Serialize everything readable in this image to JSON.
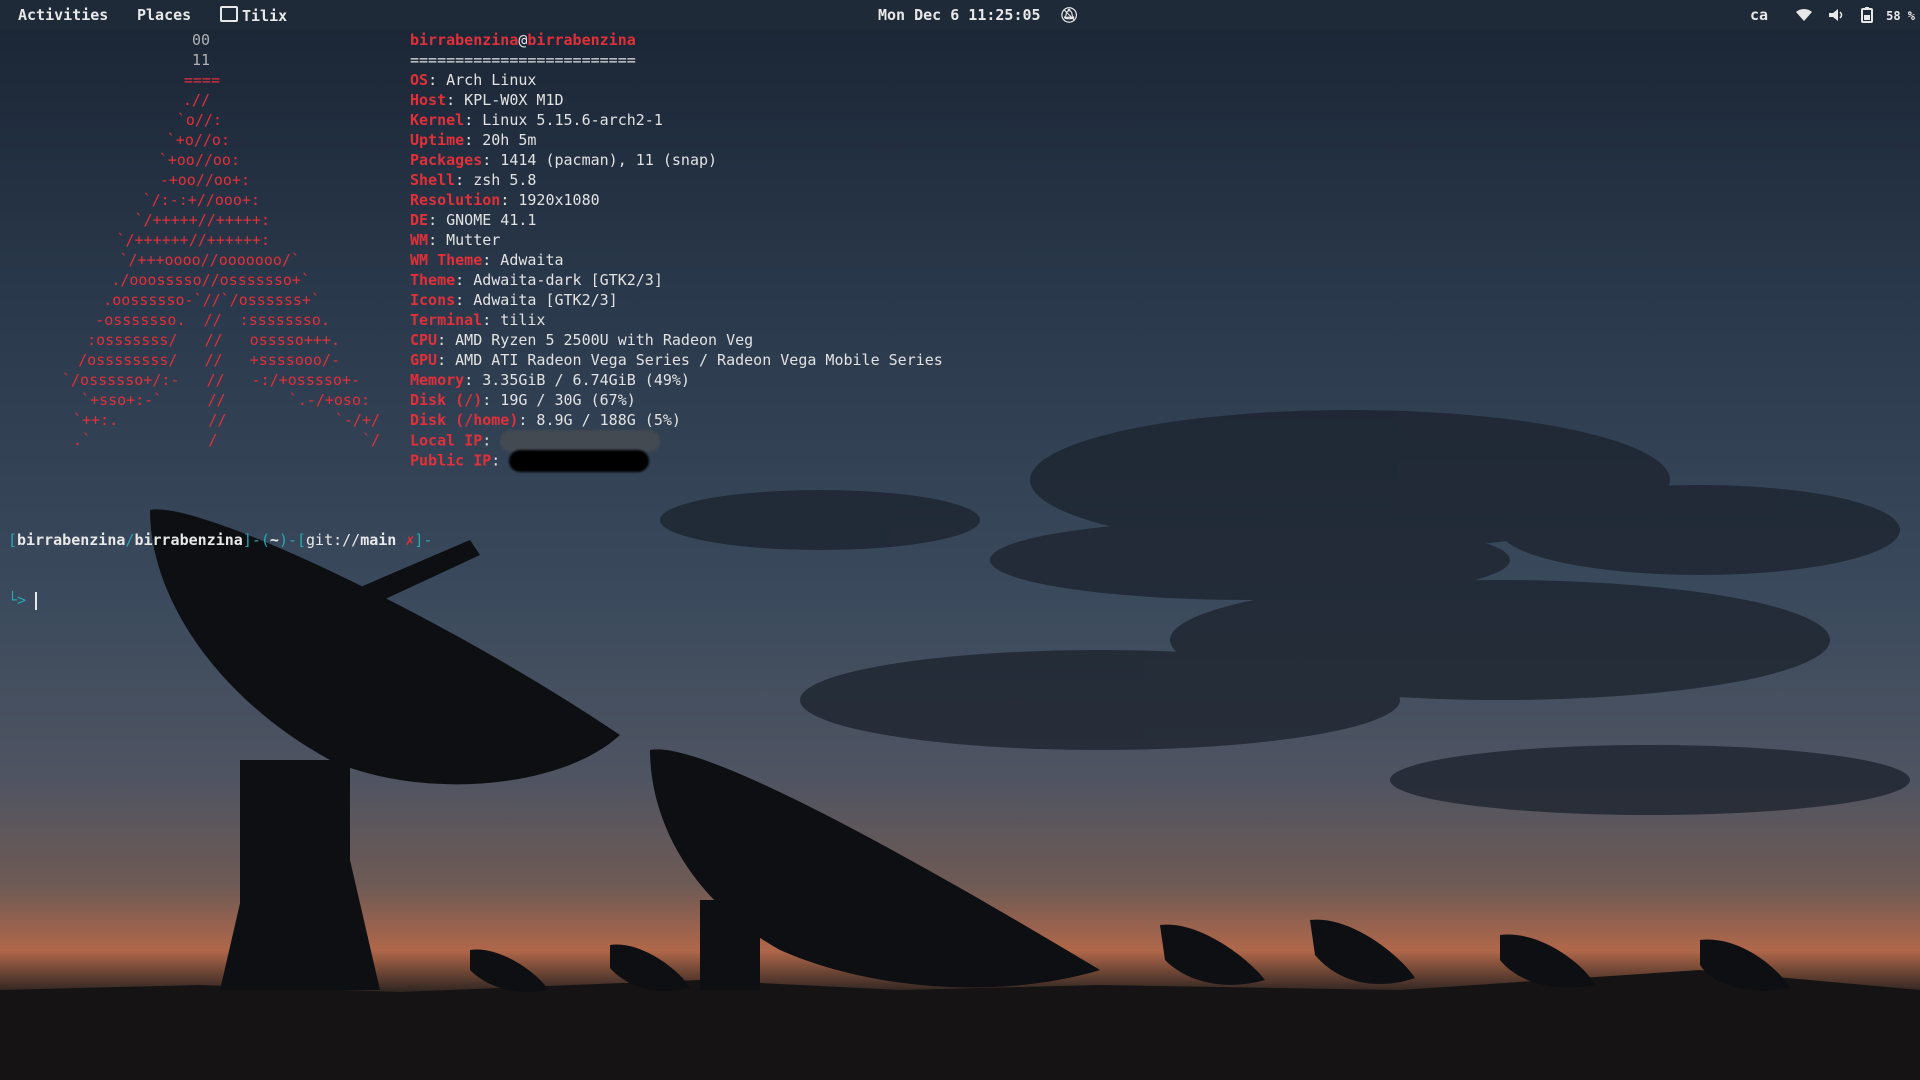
{
  "topbar": {
    "activities": "Activities",
    "places": "Places",
    "app_name": "Tilix",
    "clock": "Mon Dec 6 11:25:05",
    "keyboard_layout": "ca",
    "battery_percent": "58 %",
    "icons": [
      "terminal-icon",
      "notifications-off-icon",
      "wifi-icon",
      "volume-icon",
      "battery-icon"
    ]
  },
  "neofetch": {
    "user": "birrabenzina",
    "at": "@",
    "host": "birrabenzina",
    "separator": "=========================",
    "fields": [
      {
        "key": "OS",
        "value": ": Arch Linux"
      },
      {
        "key": "Host",
        "value": ": KPL-W0X M1D"
      },
      {
        "key": "Kernel",
        "value": ": Linux 5.15.6-arch2-1"
      },
      {
        "key": "Uptime",
        "value": ": 20h 5m"
      },
      {
        "key": "Packages",
        "value": ": 1414 (pacman), 11 (snap)"
      },
      {
        "key": "Shell",
        "value": ": zsh 5.8"
      },
      {
        "key": "Resolution",
        "value": ": 1920x1080"
      },
      {
        "key": "DE",
        "value": ": GNOME 41.1"
      },
      {
        "key": "WM",
        "value": ": Mutter"
      },
      {
        "key": "WM Theme",
        "value": ": Adwaita"
      },
      {
        "key": "Theme",
        "value": ": Adwaita-dark [GTK2/3]"
      },
      {
        "key": "Icons",
        "value": ": Adwaita [GTK2/3]"
      },
      {
        "key": "Terminal",
        "value": ": tilix"
      },
      {
        "key": "CPU",
        "value": ": AMD Ryzen 5 2500U with Radeon Veg"
      },
      {
        "key": "GPU",
        "value": ": AMD ATI Radeon Vega Series / Radeon Vega Mobile Series"
      },
      {
        "key": "Memory",
        "value": ": 3.35GiB / 6.74GiB (49%)"
      },
      {
        "key": "Disk (/)",
        "value": ": 19G / 30G (67%)"
      },
      {
        "key": "Disk (/home)",
        "value": ": 8.9G / 188G (5%)"
      },
      {
        "key": "Local IP",
        "value": ": "
      },
      {
        "key": "Public IP",
        "value": ": "
      }
    ],
    "logo_lines": [
      "00",
      "11",
      "====",
      ".//",
      "`o//:",
      "`+o//o:",
      "`+oo//oo:",
      "-+oo//oo+:",
      "`/:-:+//ooo+:",
      "`/+++++//+++++:",
      "`/++++++//++++++:",
      "`/+++oooo//ooooooo/`",
      "./ooosssso//osssssso+`",
      ".oossssso-`//`/ossssss+`",
      "-osssssso.  //  :ssssssso.",
      ":osssssss/   //   osssso+++.",
      "/ossssssss/   //   +ssssooo/-",
      "`/ossssso+/:-   //   -:/+osssso+-",
      "`+sso+:-`     //       `.-/+oso:",
      "`++:.          //            `-/+/",
      ".`             /                `/"
    ]
  },
  "prompt": {
    "open": "[",
    "user": "birrabenzina",
    "slash": "/",
    "host": "birrabenzina",
    "close_dash": "]-(",
    "dir": "~",
    "dir_close": ")-[",
    "git_prefix": "git://",
    "branch": "main",
    "dirty": "✗",
    "end": "]-",
    "second_line": "└>"
  }
}
